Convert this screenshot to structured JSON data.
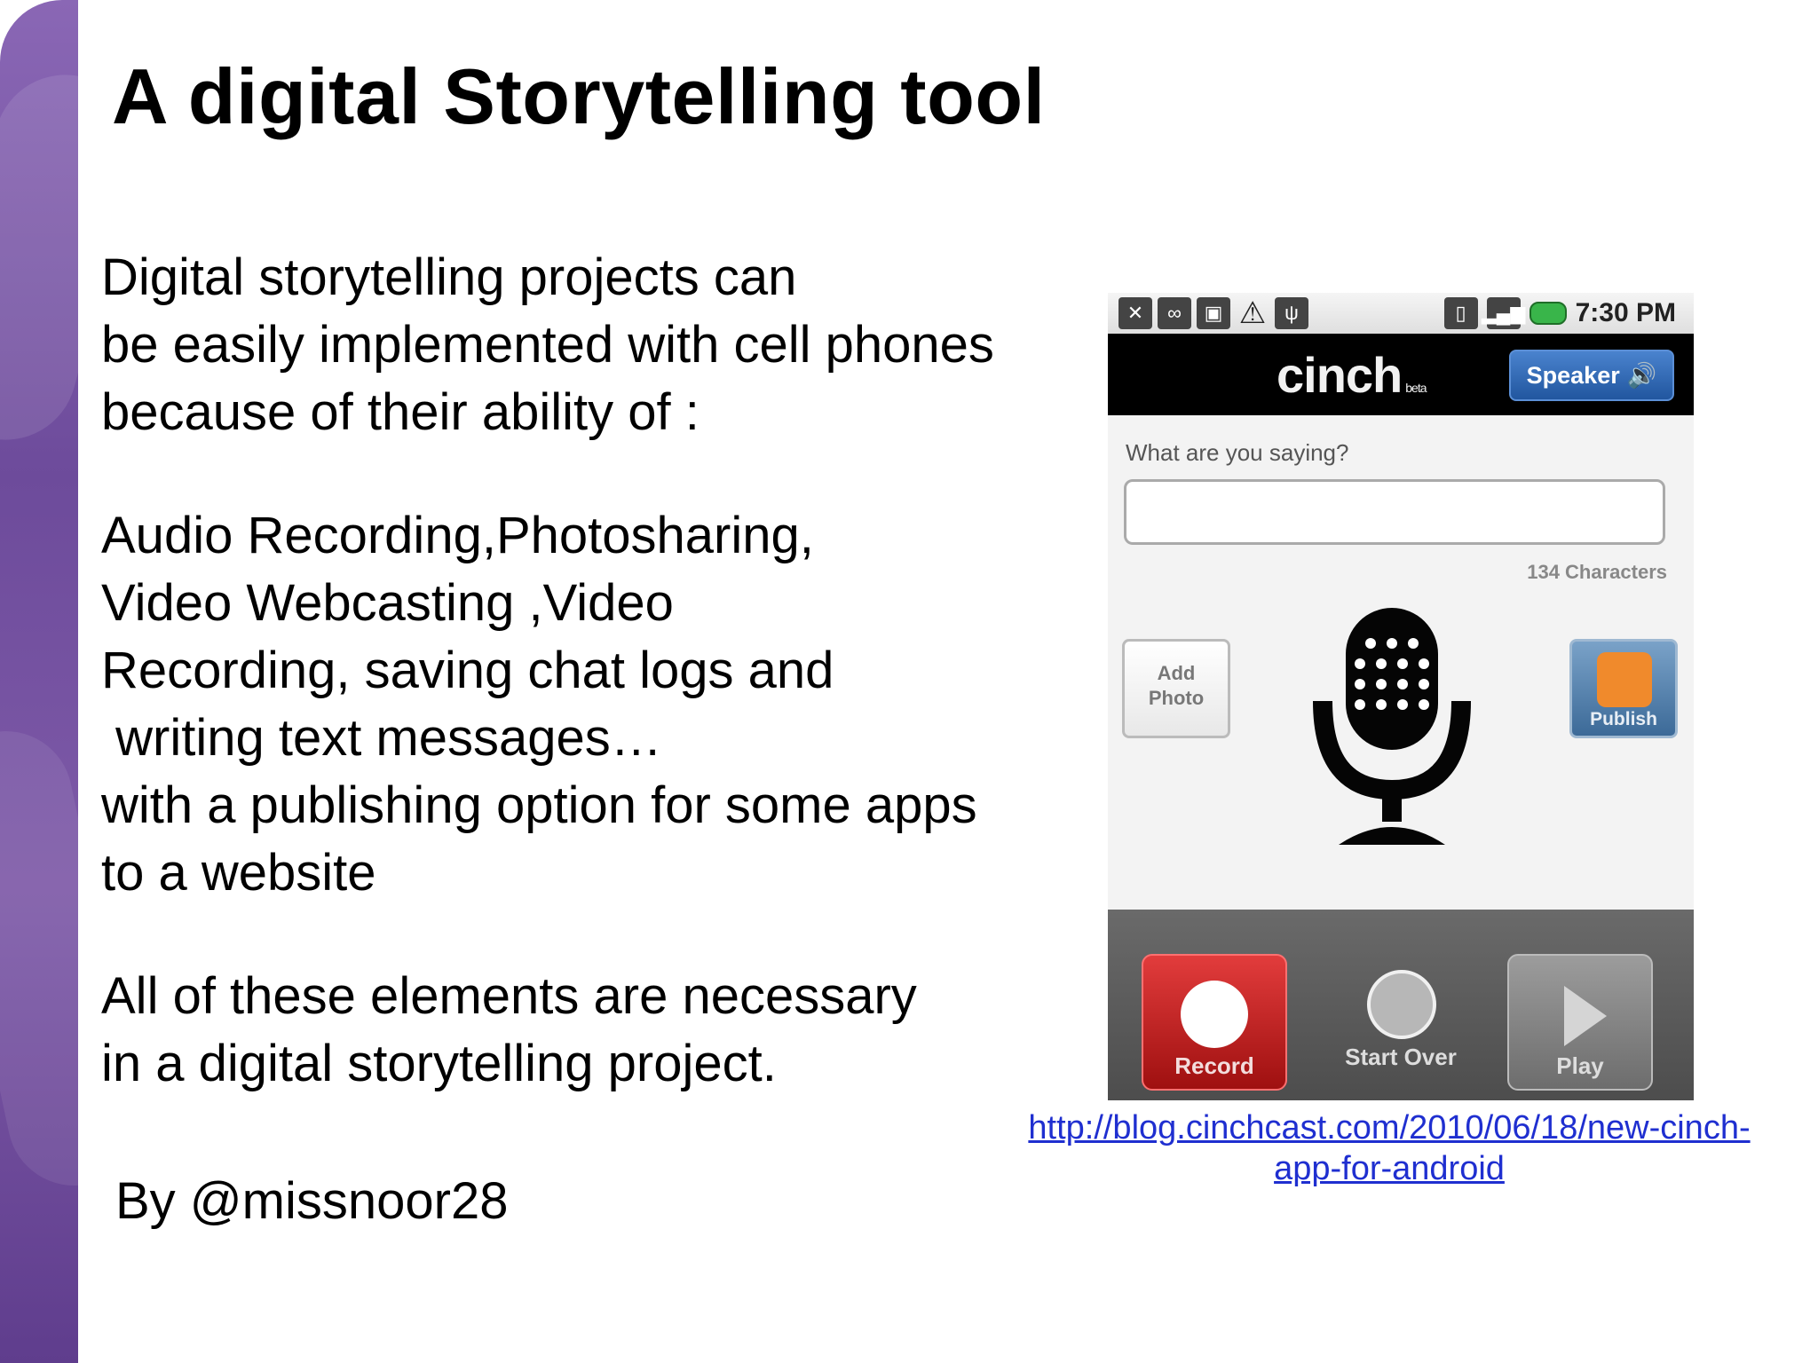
{
  "slide": {
    "title": "A digital Storytelling tool",
    "paragraphs": [
      [
        "Digital storytelling projects can",
        "be easily implemented with cell phones",
        "because of their ability of :"
      ],
      [
        "Audio Recording,Photosharing,",
        "Video Webcasting ,Video",
        "Recording, saving chat logs and",
        " writing text messages…",
        "with a publishing option for some apps",
        "to a website"
      ],
      [
        "All of these elements are necessary",
        "in a digital storytelling project."
      ]
    ],
    "author": "By @missnoor28",
    "link_text": "http://blog.cinchcast.com/2010/06/18/new-cinch-app-for-android"
  },
  "phone_screen": {
    "status_time": "7:30 PM",
    "app_name": "cinch",
    "app_badge": "beta",
    "speaker_label": "Speaker",
    "prompt": "What are you saying?",
    "message_value": "",
    "char_count": "134 Characters",
    "add_photo_label": "Add\nPhoto",
    "publish_label": "Publish",
    "record_label": "Record",
    "start_over_label": "Start Over",
    "play_label": "Play"
  },
  "colors": {
    "sidebar": "#6d4b9b",
    "link": "#1f2fd0",
    "record_red": "#c62020",
    "speaker_blue": "#2f67b3",
    "battery_green": "#39b54a"
  },
  "icons": {
    "status_left": [
      "missed-call-icon",
      "voicemail-icon",
      "sd-card-icon",
      "warning-icon",
      "usb-icon"
    ],
    "status_right": [
      "vibrate-icon",
      "signal-icon",
      "battery-icon"
    ],
    "speaker": "speaker-icon",
    "microphone": "microphone-icon",
    "publish": "rss-icon",
    "record": "record-icon",
    "start_over": "refresh-icon",
    "play": "play-icon"
  }
}
